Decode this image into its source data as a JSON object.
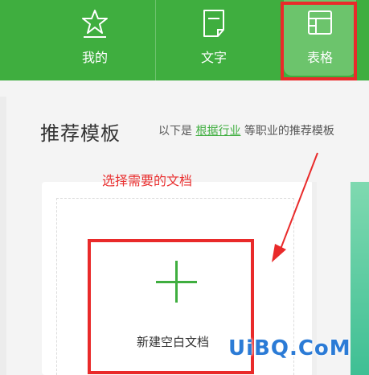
{
  "tabs": [
    {
      "label": "我的",
      "icon": "star-icon"
    },
    {
      "label": "文字",
      "icon": "document-icon"
    },
    {
      "label": "表格",
      "icon": "table-icon",
      "active": true
    }
  ],
  "section": {
    "title": "推荐模板",
    "subtitle_before": "以下是",
    "subtitle_link": "根据行业",
    "subtitle_after": "等职业的推荐模板"
  },
  "instruction": "选择需要的文档",
  "new_blank": {
    "label": "新建空白文档"
  },
  "watermark": "UiBQ.CoM",
  "colors": {
    "brand_green": "#3fae3f",
    "highlight_red": "#e92a2a"
  }
}
